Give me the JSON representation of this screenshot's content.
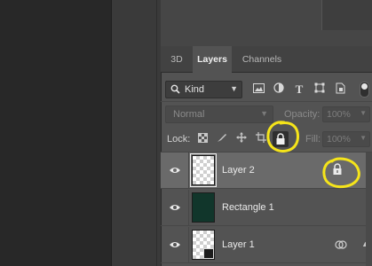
{
  "tabs": [
    {
      "label": "3D"
    },
    {
      "label": "Layers"
    },
    {
      "label": "Channels"
    }
  ],
  "filter": {
    "kind_label": "Kind",
    "icons": [
      "image-filter-icon",
      "adjustment-filter-icon",
      "type-filter-icon",
      "shape-filter-icon",
      "smart-object-filter-icon"
    ]
  },
  "blend": {
    "mode": "Normal",
    "opacity_label": "Opacity:",
    "opacity_value": "100%"
  },
  "lock": {
    "label": "Lock:",
    "fill_label": "Fill:",
    "fill_value": "100%"
  },
  "layers": [
    {
      "name": "Layer 2",
      "selected": true,
      "locked": true,
      "thumb": "transparent"
    },
    {
      "name": "Rectangle 1",
      "selected": false,
      "locked": false,
      "thumb": "fill",
      "fill_color": "#11362b"
    },
    {
      "name": "Layer 1",
      "selected": false,
      "locked": false,
      "thumb": "transparent",
      "smart_object": true
    }
  ],
  "colors": {
    "annotation": "#f5e41a",
    "panel": "#535353",
    "selected_row": "#6a6a6a"
  }
}
